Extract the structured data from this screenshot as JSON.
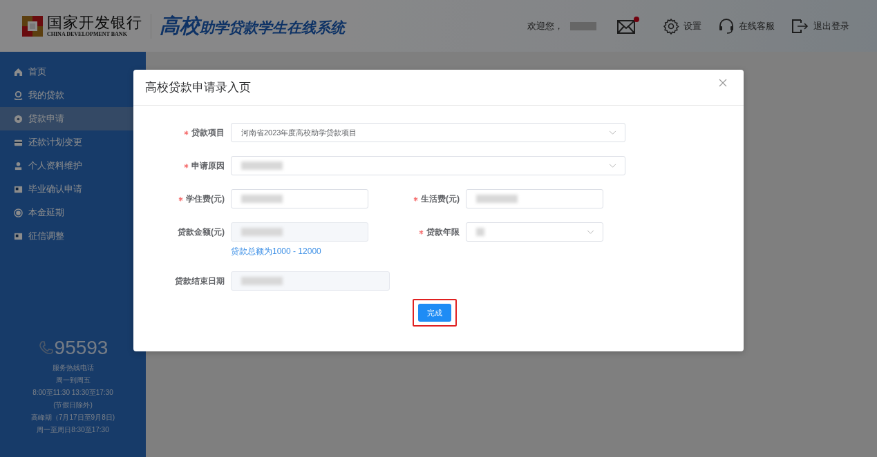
{
  "header": {
    "bank_name": "国家开发银行",
    "bank_name_en": "CHINA DEVELOPMENT BANK",
    "system_title": "高校助学贷款学生在线系统",
    "welcome": "欢迎您，",
    "user_redacted": true,
    "mail_unread": true,
    "actions": [
      {
        "kind": "settings",
        "label": "设置"
      },
      {
        "kind": "support",
        "label": "在线客服"
      },
      {
        "kind": "logout",
        "label": "退出登录"
      }
    ]
  },
  "sidebar": {
    "items": [
      {
        "kind": "home",
        "label": "首页",
        "selected": false
      },
      {
        "kind": "loan",
        "label": "我的贷款",
        "selected": false
      },
      {
        "kind": "apply",
        "label": "贷款申请",
        "selected": true
      },
      {
        "kind": "card",
        "label": "还款计划变更",
        "selected": false
      },
      {
        "kind": "person",
        "label": "个人资料维护",
        "selected": false
      },
      {
        "kind": "idcard",
        "label": "毕业确认申请",
        "selected": false
      },
      {
        "kind": "radio",
        "label": "本金延期",
        "selected": false
      },
      {
        "kind": "idcard",
        "label": "征信调整",
        "selected": false
      }
    ],
    "hotline": {
      "number": "95593",
      "lines": [
        "服务热线电话",
        "周一到周五",
        "8:00至11:30 13:30至17:30",
        "(节假日除外)",
        "高峰期（7月17日至9月8日)",
        "周一至周日8:30至17:30"
      ]
    }
  },
  "dialog": {
    "title": "高校贷款申请录入页",
    "rows": [
      [
        {
          "label": "贷款项目",
          "required": true,
          "kind": "select",
          "value": "河南省2023年度高校助学贷款项目",
          "redacted": false
        }
      ],
      [
        {
          "label": "申请原因",
          "required": true,
          "kind": "select",
          "redacted": true
        }
      ],
      [
        {
          "label": "学住费(元)",
          "required": true,
          "kind": "input",
          "redacted": true
        },
        {
          "label": "生活费(元)",
          "required": true,
          "kind": "input",
          "redacted": true
        }
      ],
      [
        {
          "label": "贷款金额(元)",
          "required": false,
          "kind": "readonly",
          "redacted": true,
          "hint": "贷款总额为1000 - 12000"
        },
        {
          "label": "贷款年限",
          "required": true,
          "kind": "select",
          "redacted": true
        }
      ],
      [
        {
          "label": "贷款结束日期",
          "required": false,
          "kind": "readonly",
          "redacted": true
        }
      ]
    ],
    "submit": {
      "label": "完成",
      "highlighted": true
    }
  }
}
